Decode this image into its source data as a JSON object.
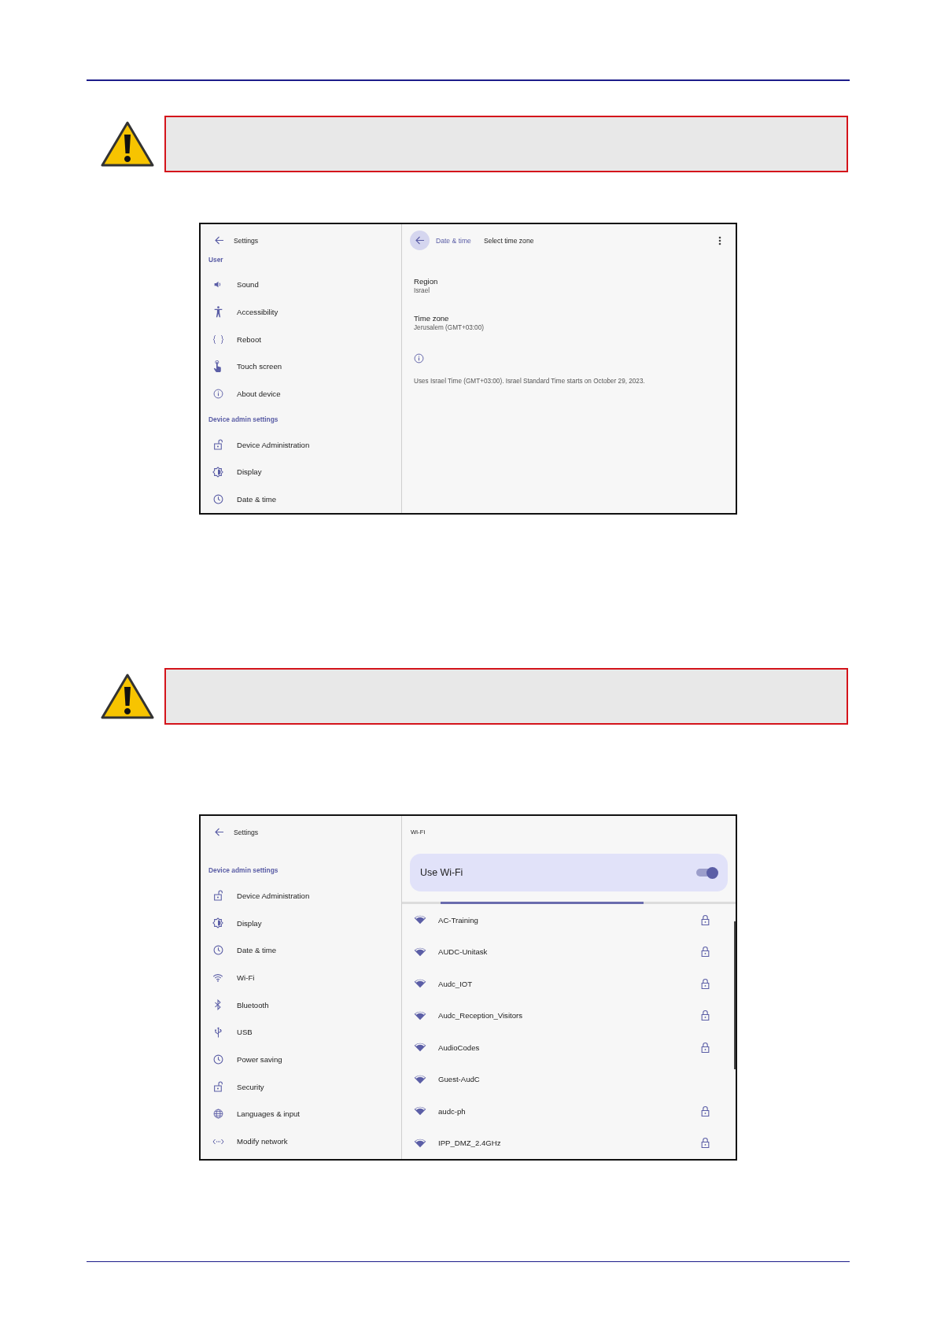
{
  "blocks": [
    {
      "kind": "warning"
    },
    {
      "kind": "screen",
      "screen": {
        "kind": "time_zone",
        "sidebar": {
          "title": "Settings",
          "sections": [
            {
              "heading": "User",
              "items": [
                {
                  "label": "Sound",
                  "kind": "sound"
                },
                {
                  "label": "Accessibility",
                  "kind": "accessibility"
                },
                {
                  "label": "Reboot",
                  "kind": "reboot"
                },
                {
                  "label": "Touch screen",
                  "kind": "touch"
                },
                {
                  "label": "About device",
                  "kind": "about"
                }
              ]
            },
            {
              "heading": "Device admin settings",
              "items": [
                {
                  "label": "Device Administration",
                  "kind": "lock"
                },
                {
                  "label": "Display",
                  "kind": "display"
                },
                {
                  "label": "Date & time",
                  "kind": "clock"
                }
              ]
            }
          ]
        },
        "detail": {
          "breadcrumb": "Date & time",
          "title": "Select time zone",
          "prefs": [
            {
              "title": "Region",
              "summary": "Israel"
            },
            {
              "title": "Time zone",
              "summary": "Jerusalem (GMT+03:00)"
            }
          ],
          "footer": "Uses Israel Time (GMT+03:00). Israel Standard Time starts on October 29, 2023."
        }
      }
    },
    {
      "kind": "warning"
    },
    {
      "kind": "screen",
      "screen": {
        "kind": "wifi",
        "sidebar": {
          "title": "Settings",
          "sections": [
            {
              "heading": "Device admin settings",
              "items": [
                {
                  "label": "Device Administration",
                  "kind": "lock"
                },
                {
                  "label": "Display",
                  "kind": "display"
                },
                {
                  "label": "Date & time",
                  "kind": "clock"
                },
                {
                  "label": "Wi-Fi",
                  "kind": "wifi"
                },
                {
                  "label": "Bluetooth",
                  "kind": "bluetooth"
                },
                {
                  "label": "USB",
                  "kind": "usb"
                },
                {
                  "label": "Power saving",
                  "kind": "clock"
                },
                {
                  "label": "Security",
                  "kind": "lock"
                },
                {
                  "label": "Languages & input",
                  "kind": "globe"
                },
                {
                  "label": "Modify network",
                  "kind": "network"
                }
              ]
            }
          ]
        },
        "detail": {
          "title": "Wi-Fi",
          "switch": {
            "label": "Use Wi-Fi",
            "on": true
          },
          "progress": {
            "kind": "indeterminate"
          },
          "networks": [
            {
              "name": "AC-Training",
              "secured": true
            },
            {
              "name": "AUDC-Unitask",
              "secured": true
            },
            {
              "name": "Audc_IOT",
              "secured": true
            },
            {
              "name": "Audc_Reception_Visitors",
              "secured": true
            },
            {
              "name": "AudioCodes",
              "secured": true
            },
            {
              "name": "Guest-AudC",
              "secured": false
            },
            {
              "name": "audc-ph",
              "secured": true
            },
            {
              "name": "IPP_DMZ_2.4GHz",
              "secured": true
            }
          ]
        }
      }
    }
  ]
}
